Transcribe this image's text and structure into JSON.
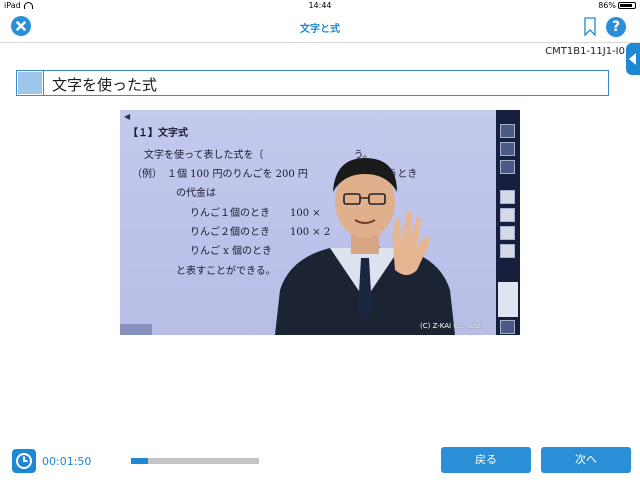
{
  "status_bar": {
    "device": "iPad",
    "time": "14:44",
    "battery_text": "86%",
    "battery_level": 0.86
  },
  "nav": {
    "title": "文字と式",
    "close_icon": "close-icon",
    "bookmark_icon": "bookmark-icon",
    "help_label": "?"
  },
  "doc_code": "CMT1B1-11J1-I0",
  "section_title": "文字を使った式",
  "video": {
    "board_lines": [
      "【１】文字式",
      "文字を使って表した式を〔　　　　　　　　　う。",
      "（例）　１個 100 円のりんごを 200 円　　　　　てもらうとき",
      "の代金は",
      "りんご１個のとき　　100 ×　　　　円）",
      "りんご２個のとき　　100 × 2　　　円）",
      "りんご x 個のとき　　　　　　　　　（円）",
      "と表すことができる。"
    ],
    "copyright": "(C) Z-KAI Co., Ltd."
  },
  "footer": {
    "elapsed": "00:01:50",
    "progress": 0.13,
    "back_label": "戻る",
    "next_label": "次へ"
  },
  "colors": {
    "accent": "#1e88d2",
    "title_accent": "#9cc6ea",
    "progress_track": "#c4c4c4"
  }
}
